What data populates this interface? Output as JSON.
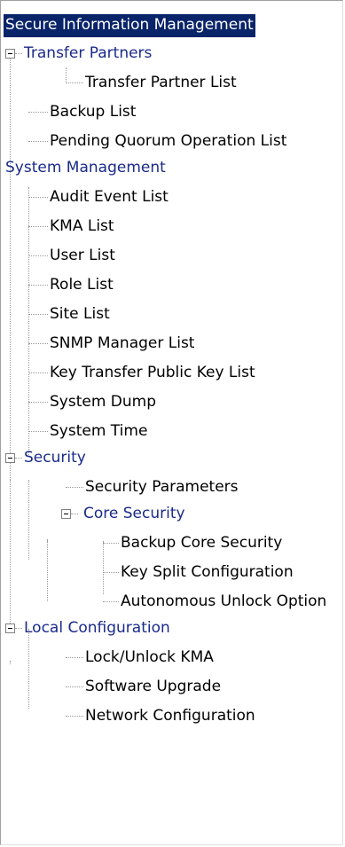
{
  "tree": {
    "root": {
      "label": "Secure Information Management"
    },
    "transfer_partners": {
      "label": "Transfer Partners",
      "children": [
        "Transfer Partner List"
      ]
    },
    "sim_items": [
      "Backup List",
      "Pending Quorum Operation List"
    ],
    "system_management": {
      "label": "System Management",
      "children": [
        "Audit Event List",
        "KMA List",
        "User List",
        "Role List",
        "Site List",
        "SNMP Manager List",
        "Key Transfer Public Key List",
        "System Dump",
        "System Time"
      ]
    },
    "security": {
      "label": "Security",
      "security_parameters": "Security Parameters",
      "core_security": {
        "label": "Core Security",
        "children": [
          "Backup Core Security",
          "Key Split Configuration",
          "Autonomous Unlock Option"
        ]
      }
    },
    "local_configuration": {
      "label": "Local Configuration",
      "children": [
        "Lock/Unlock KMA",
        "Software Upgrade",
        "Network Configuration"
      ]
    }
  }
}
